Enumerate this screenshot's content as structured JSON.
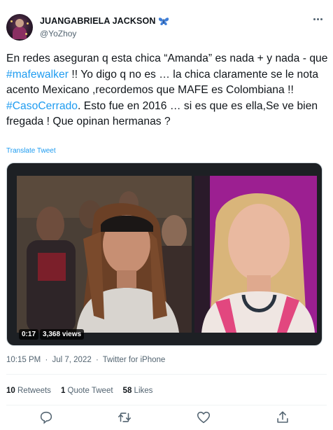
{
  "author": {
    "display_name": "JUANGABRIELA JACKSON",
    "handle": "@YoZhoy",
    "badge_emoji": "butterfly-icon"
  },
  "tweet": {
    "text_parts": {
      "p1": "En redes aseguran q esta chica “Amanda” es nada + y nada - que ",
      "tag1": "#mafewalker",
      "p2": " !! Yo digo q no es … la chica claramente se le nota acento Mexicano ,recordemos que MAFE es Colombiana !! ",
      "tag2": "#CasoCerrado",
      "p3": ". Esto fue en 2016 … si es que es ella,Se ve bien fregada !  Que opinan hermanas ?"
    },
    "translate_label": "Translate Tweet"
  },
  "media": {
    "duration": "0:17",
    "views": "3,368 views"
  },
  "meta": {
    "time": "10:15 PM",
    "separator1": "·",
    "date": "Jul 7, 2022",
    "separator2": "·",
    "source": "Twitter for iPhone"
  },
  "stats": {
    "retweets_count": "10",
    "retweets_label": "Retweets",
    "quotes_count": "1",
    "quotes_label": "Quote Tweet",
    "likes_count": "58",
    "likes_label": "Likes"
  },
  "colors": {
    "accent": "#1d9bf0",
    "secondary_text": "#536471",
    "primary_text": "#0f1419"
  },
  "actions": [
    "reply-icon",
    "retweet-icon",
    "like-icon",
    "share-icon"
  ]
}
